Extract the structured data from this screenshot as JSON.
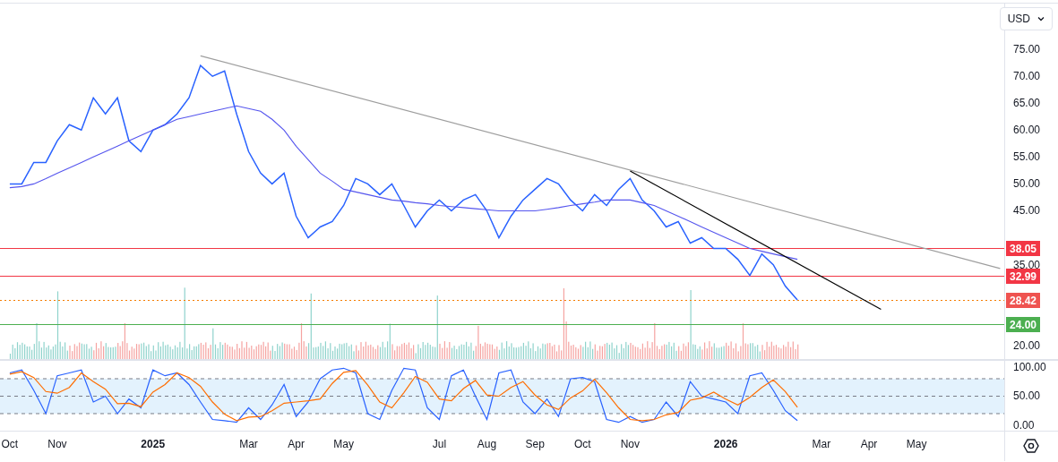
{
  "currency_select": {
    "value": "USD"
  },
  "price_chart": {
    "chart_data": {
      "type": "line",
      "x": [
        2024.75,
        2024.771,
        2024.792,
        2024.813,
        2024.833,
        2024.854,
        2024.875,
        2024.896,
        2024.917,
        2024.938,
        2024.958,
        2024.979,
        2025.0,
        2025.021,
        2025.042,
        2025.063,
        2025.083,
        2025.104,
        2025.125,
        2025.146,
        2025.167,
        2025.188,
        2025.208,
        2025.229,
        2025.25,
        2025.271,
        2025.292,
        2025.313,
        2025.333,
        2025.354,
        2025.375,
        2025.396,
        2025.417,
        2025.438,
        2025.458,
        2025.479,
        2025.5,
        2025.521,
        2025.542,
        2025.563,
        2025.583,
        2025.604,
        2025.625,
        2025.646,
        2025.667,
        2025.688,
        2025.708,
        2025.729,
        2025.75,
        2025.771,
        2025.792,
        2025.813,
        2025.833,
        2025.854,
        2025.875,
        2025.896,
        2025.917,
        2025.938,
        2025.958,
        2025.979,
        2026.0,
        2026.021,
        2026.042,
        2026.063,
        2026.083,
        2026.104,
        2026.125,
        2026.271,
        2026.479
      ],
      "series": [
        {
          "color": "#2962ff",
          "values": [
            50,
            50,
            54,
            54,
            58,
            61,
            60,
            66,
            63,
            66,
            58,
            56,
            60,
            61,
            63,
            66,
            72,
            70,
            71,
            63,
            56,
            52,
            50,
            52,
            44,
            40,
            42,
            43,
            46,
            51,
            50,
            48,
            50,
            46,
            42,
            45,
            47,
            45,
            47,
            48,
            45,
            40,
            44,
            47,
            49,
            51,
            50,
            47,
            45,
            48,
            46,
            49,
            51,
            47,
            45,
            42,
            43,
            39,
            40,
            38,
            38,
            36,
            33,
            37,
            35,
            31,
            28.42,
            null,
            null
          ]
        },
        {
          "color": "#5555ee",
          "values": [
            49.3,
            49.5,
            50,
            51,
            52,
            53,
            54,
            55,
            56,
            57,
            58,
            59,
            60,
            61,
            62,
            62.5,
            63,
            63.5,
            64,
            64.5,
            64,
            63.5,
            62,
            60,
            57,
            54.5,
            52,
            50.5,
            49,
            48.5,
            48,
            47.5,
            47,
            46.8,
            46.5,
            46.3,
            46,
            45.8,
            45.6,
            45.4,
            45.2,
            45,
            45,
            45,
            45,
            45.3,
            45.6,
            46,
            46.3,
            46.6,
            47,
            47,
            47,
            46.5,
            46,
            45,
            44,
            43,
            42,
            41,
            40,
            39,
            38,
            37.5,
            37,
            36.5,
            36,
            null,
            null
          ]
        },
        {
          "color": "#9e9e9e",
          "values": [
            null,
            null,
            null,
            null,
            null,
            null,
            null,
            null,
            null,
            null,
            null,
            null,
            null,
            null,
            null,
            null,
            73.8,
            null,
            null,
            null,
            null,
            null,
            null,
            null,
            null,
            null,
            null,
            null,
            null,
            null,
            null,
            null,
            null,
            null,
            null,
            null,
            null,
            null,
            null,
            null,
            null,
            null,
            null,
            null,
            null,
            null,
            null,
            null,
            null,
            null,
            null,
            null,
            null,
            null,
            null,
            null,
            null,
            null,
            null,
            null,
            null,
            null,
            null,
            null,
            null,
            null,
            null,
            null,
            34.3
          ]
        },
        {
          "color": "#000000",
          "values": [
            null,
            null,
            null,
            null,
            null,
            null,
            null,
            null,
            null,
            null,
            null,
            null,
            null,
            null,
            null,
            null,
            null,
            null,
            null,
            null,
            null,
            null,
            null,
            null,
            null,
            null,
            null,
            null,
            null,
            null,
            null,
            null,
            null,
            null,
            null,
            null,
            null,
            null,
            null,
            null,
            null,
            null,
            null,
            null,
            null,
            null,
            null,
            null,
            null,
            null,
            null,
            null,
            52.4,
            null,
            null,
            null,
            null,
            null,
            null,
            null,
            null,
            null,
            null,
            null,
            null,
            null,
            null,
            26.7,
            null
          ]
        }
      ],
      "xlim": [
        2024.733,
        2026.58
      ],
      "ylim": [
        17.3,
        83.5
      ],
      "yticks": [
        {
          "value": 20,
          "label": "20.00"
        },
        {
          "value": 35,
          "label": "35.00"
        },
        {
          "value": 45,
          "label": "45.00"
        },
        {
          "value": 50,
          "label": "50.00"
        },
        {
          "value": 55,
          "label": "55.00"
        },
        {
          "value": 60,
          "label": "60.00"
        },
        {
          "value": 65,
          "label": "65.00"
        },
        {
          "value": 70,
          "label": "70.00"
        },
        {
          "value": 75,
          "label": "75.00"
        }
      ]
    }
  },
  "price_levels": [
    {
      "label": "38.05",
      "color": "#f23645"
    },
    {
      "label": "32.99",
      "color": "#f23645"
    },
    {
      "label": "28.42",
      "color": "#ef5350"
    },
    {
      "label": "24.00",
      "color": "#4caf50"
    }
  ],
  "stochastic_chart": {
    "chart_data": {
      "type": "line",
      "x": [
        2024.75,
        2024.771,
        2024.792,
        2024.813,
        2024.833,
        2024.854,
        2024.875,
        2024.896,
        2024.917,
        2024.938,
        2024.958,
        2024.979,
        2025.0,
        2025.021,
        2025.042,
        2025.063,
        2025.083,
        2025.104,
        2025.125,
        2025.146,
        2025.167,
        2025.188,
        2025.208,
        2025.229,
        2025.25,
        2025.271,
        2025.292,
        2025.313,
        2025.333,
        2025.354,
        2025.375,
        2025.396,
        2025.417,
        2025.438,
        2025.458,
        2025.479,
        2025.5,
        2025.521,
        2025.542,
        2025.563,
        2025.583,
        2025.604,
        2025.625,
        2025.646,
        2025.667,
        2025.688,
        2025.708,
        2025.729,
        2025.75,
        2025.771,
        2025.792,
        2025.813,
        2025.833,
        2025.854,
        2025.875,
        2025.896,
        2025.917,
        2025.938,
        2025.958,
        2025.979,
        2026.0,
        2026.021,
        2026.042,
        2026.063,
        2026.083,
        2026.104,
        2026.125
      ],
      "series": [
        {
          "color": "#2962ff",
          "values": [
            90,
            95,
            60,
            20,
            85,
            90,
            95,
            40,
            50,
            20,
            45,
            30,
            95,
            85,
            90,
            70,
            40,
            10,
            8,
            5,
            30,
            10,
            35,
            70,
            15,
            40,
            80,
            95,
            98,
            90,
            20,
            10,
            60,
            98,
            95,
            30,
            10,
            85,
            95,
            50,
            10,
            90,
            95,
            40,
            20,
            45,
            15,
            80,
            82,
            75,
            10,
            5,
            15,
            5,
            10,
            40,
            15,
            75,
            50,
            45,
            40,
            20,
            85,
            90,
            60,
            25,
            8
          ]
        },
        {
          "color": "#ff6d00",
          "values": [
            88,
            92,
            82,
            58,
            55,
            65,
            90,
            75,
            62,
            37,
            38,
            32,
            57,
            70,
            90,
            82,
            67,
            40,
            19,
            8,
            14,
            15,
            25,
            38,
            40,
            42,
            45,
            72,
            91,
            94,
            69,
            40,
            30,
            56,
            84,
            74,
            45,
            42,
            63,
            77,
            52,
            50,
            65,
            75,
            52,
            35,
            27,
            47,
            59,
            79,
            56,
            30,
            10,
            8,
            10,
            18,
            22,
            43,
            47,
            57,
            45,
            35,
            48,
            65,
            78,
            58,
            31
          ]
        }
      ],
      "xlim": [
        2024.733,
        2026.58
      ],
      "ylim": [
        -10.8,
        112.3
      ],
      "yticks": [
        {
          "value": 0,
          "label": "0.00"
        },
        {
          "value": 50,
          "label": "50.00"
        },
        {
          "value": 100,
          "label": "100.00"
        }
      ],
      "xticks": [
        {
          "value": 2024.75,
          "label": "Oct"
        },
        {
          "value": 2024.833,
          "label": "Nov"
        },
        {
          "value": 2025,
          "label": "2025"
        },
        {
          "value": 2025.167,
          "label": "Mar"
        },
        {
          "value": 2025.25,
          "label": "Apr"
        },
        {
          "value": 2025.333,
          "label": "May"
        },
        {
          "value": 2025.5,
          "label": "Jul"
        },
        {
          "value": 2025.583,
          "label": "Aug"
        },
        {
          "value": 2025.667,
          "label": "Sep"
        },
        {
          "value": 2025.75,
          "label": "Oct"
        },
        {
          "value": 2025.833,
          "label": "Nov"
        },
        {
          "value": 2026,
          "label": "2026"
        },
        {
          "value": 2026.167,
          "label": "Mar"
        },
        {
          "value": 2026.25,
          "label": "Apr"
        },
        {
          "value": 2026.333,
          "label": "May"
        }
      ]
    }
  }
}
